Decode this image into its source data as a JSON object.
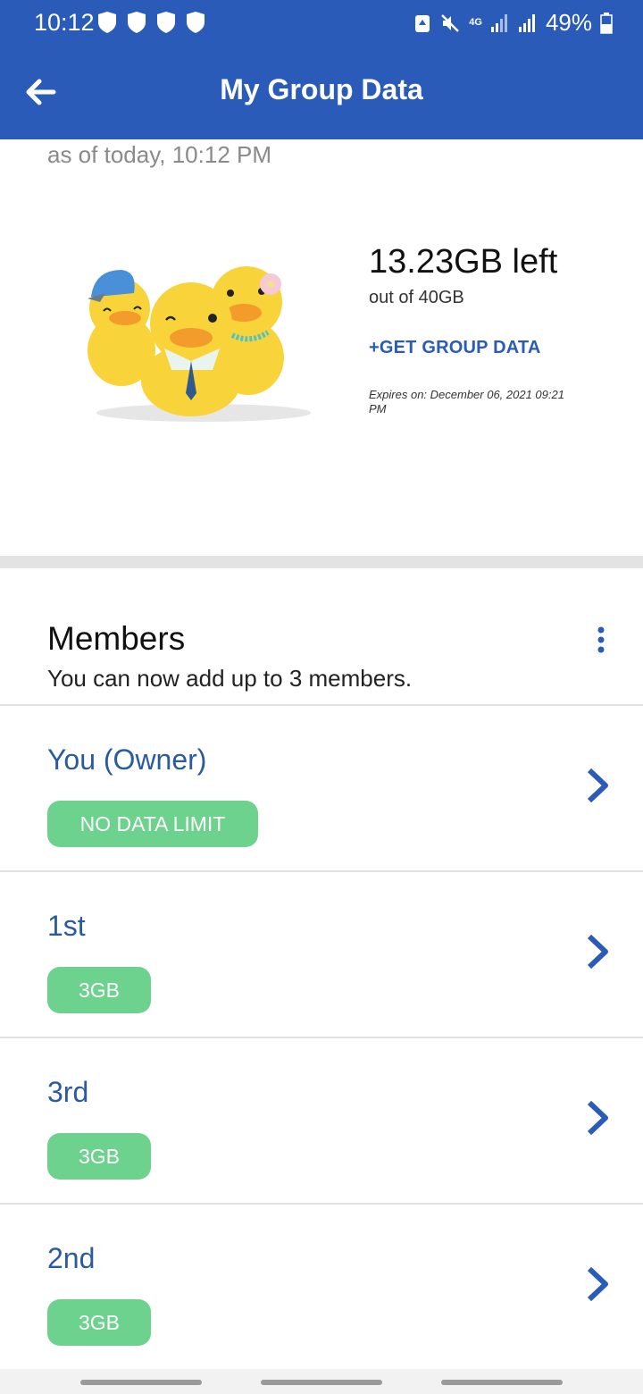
{
  "status_bar": {
    "time": "10:12",
    "network": "4G",
    "battery": "49%",
    "icons": [
      "shield-icon",
      "shield-icon",
      "shield-icon",
      "shield-icon",
      "recycle-icon",
      "mute-icon",
      "signal-icon",
      "signal-icon",
      "battery-icon"
    ]
  },
  "app_bar": {
    "title": "My Group Data",
    "back_icon": "arrow-left-icon"
  },
  "summary": {
    "as_of": "as of today, 10:12 PM",
    "data_left": "13.23GB left",
    "out_of": "out of 40GB",
    "get_group_data": "+GET GROUP DATA",
    "expires": "Expires on: December 06, 2021 09:21 PM"
  },
  "members": {
    "title": "Members",
    "subtitle": "You can now add up to 3 members.",
    "menu_icon": "more-vertical-icon",
    "list": [
      {
        "name": "You (Owner)",
        "limit": "NO DATA LIMIT"
      },
      {
        "name": "1st",
        "limit": "3GB"
      },
      {
        "name": "3rd",
        "limit": "3GB"
      },
      {
        "name": "2nd",
        "limit": "3GB"
      }
    ]
  },
  "colors": {
    "primary": "#2a5bb8",
    "member_name": "#2a5b9e",
    "pill": "#6dd28e"
  }
}
